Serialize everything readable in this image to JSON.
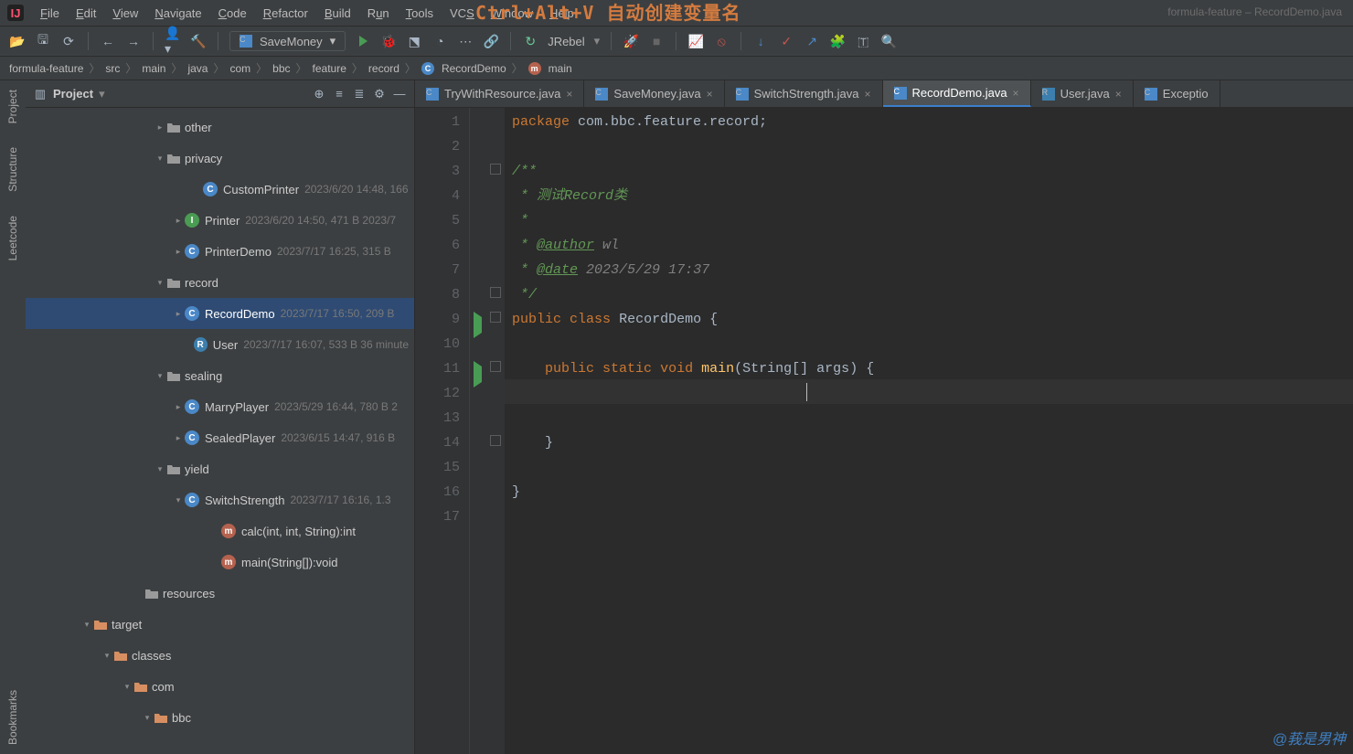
{
  "overlay": "Ctrl+Alt+V 自动创建变量名",
  "window_title_hint": "formula-feature – RecordDemo.java",
  "menubar": [
    "File",
    "Edit",
    "View",
    "Navigate",
    "Code",
    "Refactor",
    "Build",
    "Run",
    "Tools",
    "VCS",
    "Window",
    "Help"
  ],
  "toolbar": {
    "run_config": "SaveMoney",
    "jrebel_label": "JRebel"
  },
  "breadcrumbs": [
    "formula-feature",
    "src",
    "main",
    "java",
    "com",
    "bbc",
    "feature",
    "record",
    "RecordDemo",
    "main"
  ],
  "sidebar_tabs": [
    "Project",
    "Structure",
    "Leetcode",
    "Bookmarks"
  ],
  "project_panel": {
    "title": "Project",
    "nodes": [
      {
        "indent": 140,
        "arrow": "▸",
        "type": "folder",
        "name": "other"
      },
      {
        "indent": 140,
        "arrow": "▾",
        "type": "folder",
        "name": "privacy"
      },
      {
        "indent": 180,
        "arrow": "",
        "type": "class-c",
        "name": "CustomPrinter",
        "meta": "2023/6/20 14:48, 166"
      },
      {
        "indent": 160,
        "arrow": "▸",
        "type": "class-i",
        "name": "Printer",
        "meta": "2023/6/20 14:50, 471 B 2023/7"
      },
      {
        "indent": 160,
        "arrow": "▸",
        "type": "class-c",
        "name": "PrinterDemo",
        "meta": "2023/7/17 16:25, 315 B"
      },
      {
        "indent": 140,
        "arrow": "▾",
        "type": "folder",
        "name": "record"
      },
      {
        "indent": 160,
        "arrow": "▸",
        "type": "class-c",
        "name": "RecordDemo",
        "meta": "2023/7/17 16:50, 209 B",
        "sel": true
      },
      {
        "indent": 180,
        "arrow": "",
        "type": "class-r",
        "name": "User",
        "meta": "2023/7/17 16:07, 533 B 36 minute"
      },
      {
        "indent": 140,
        "arrow": "▾",
        "type": "folder",
        "name": "sealing"
      },
      {
        "indent": 160,
        "arrow": "▸",
        "type": "class-c",
        "name": "MarryPlayer",
        "meta": "2023/5/29 16:44, 780 B 2"
      },
      {
        "indent": 160,
        "arrow": "▸",
        "type": "class-c",
        "name": "SealedPlayer",
        "meta": "2023/6/15 14:47, 916 B"
      },
      {
        "indent": 140,
        "arrow": "▾",
        "type": "folder",
        "name": "yield"
      },
      {
        "indent": 160,
        "arrow": "▾",
        "type": "class-c",
        "name": "SwitchStrength",
        "meta": "2023/7/17 16:16, 1.3"
      },
      {
        "indent": 200,
        "arrow": "",
        "type": "method",
        "name": "calc(int, int, String):int"
      },
      {
        "indent": 200,
        "arrow": "",
        "type": "method",
        "name": "main(String[]):void"
      },
      {
        "indent": 116,
        "arrow": "",
        "type": "res-folder",
        "name": "resources"
      },
      {
        "indent": 60,
        "arrow": "▾",
        "type": "mod-folder",
        "name": "target"
      },
      {
        "indent": 82,
        "arrow": "▾",
        "type": "mod-folder",
        "name": "classes"
      },
      {
        "indent": 104,
        "arrow": "▾",
        "type": "mod-folder",
        "name": "com"
      },
      {
        "indent": 126,
        "arrow": "▾",
        "type": "mod-folder",
        "name": "bbc"
      }
    ]
  },
  "tabs": [
    {
      "icon": "c",
      "label": "TryWithResource.java",
      "active": false
    },
    {
      "icon": "c",
      "label": "SaveMoney.java",
      "active": false
    },
    {
      "icon": "c",
      "label": "SwitchStrength.java",
      "active": false
    },
    {
      "icon": "c",
      "label": "RecordDemo.java",
      "active": true
    },
    {
      "icon": "r",
      "label": "User.java",
      "active": false
    },
    {
      "icon": "c",
      "label": "Exceptio",
      "active": false
    }
  ],
  "code": {
    "lines": 17,
    "package_kw": "package",
    "package_name": "com.bbc.feature.record",
    "doc_open": "/**",
    "doc_desc": " * 测试Record类",
    "doc_empty": " *",
    "doc_author_tag": "@author",
    "doc_author_val": "wl",
    "doc_date_tag": "@date",
    "doc_date_val": "2023/5/29 17:37",
    "doc_close": " */",
    "public": "public",
    "class": "class",
    "cls_name": "RecordDemo",
    "static": "static",
    "void": "void",
    "main": "main",
    "String": "String",
    "args": "args"
  },
  "watermark": "@莪是男神"
}
